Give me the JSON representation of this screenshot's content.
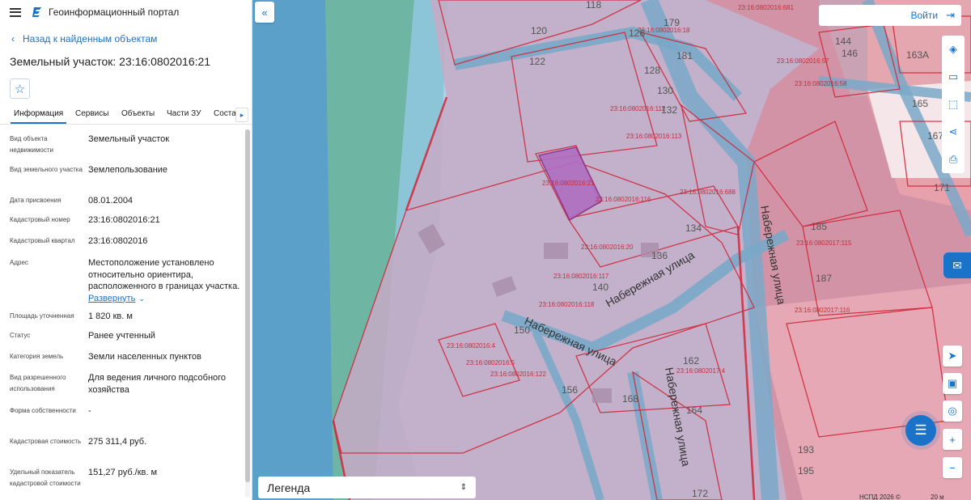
{
  "header": {
    "app_title": "Геоинформационный портал",
    "menu_icon": "menu-icon",
    "logo_icon": "portal-logo-icon"
  },
  "back_link": "Назад к найденным объектам",
  "object_title": "Земельный участок: 23:16:0802016:21",
  "favorite_icon": "star-icon",
  "tabs": [
    {
      "label": "Информация",
      "active": true
    },
    {
      "label": "Сервисы"
    },
    {
      "label": "Объекты"
    },
    {
      "label": "Части ЗУ"
    },
    {
      "label": "Соста"
    }
  ],
  "properties": [
    {
      "label": "Вид объекта недвижимости",
      "value": "Земельный участок"
    },
    {
      "label": "Вид земельного участка",
      "value": "Землепользование"
    },
    {
      "label": "Дата присвоения",
      "value": "08.01.2004"
    },
    {
      "label": "Кадастровый номер",
      "value": "23:16:0802016:21"
    },
    {
      "label": "Кадастровый квартал",
      "value": "23:16:0802016"
    },
    {
      "label": "Адрес",
      "value": "Местоположение установлено относительно ориентира, расположенного в границах участка.",
      "expand_label": "Развернуть"
    },
    {
      "label": "Площадь уточненная",
      "value": "1 820 кв. м"
    },
    {
      "label": "Статус",
      "value": "Ранее учтенный"
    },
    {
      "label": "Категория земель",
      "value": "Земли населенных пунктов"
    },
    {
      "label": "Вид разрешенного использования",
      "value": "Для ведения личного подсобного хозяйства"
    },
    {
      "label": "Форма собственности",
      "value": "-"
    },
    {
      "label": "Кадастровая стоимость",
      "value": "275 311,4 руб."
    },
    {
      "label": "Удельный показатель кадастровой стоимости",
      "value": "151,27 руб./кв. м"
    }
  ],
  "map": {
    "login_label": "Войти",
    "legend_label": "Легенда",
    "attribution": "НСПД 2026 ©",
    "scale_label": "20 м",
    "street_labels": [
      "Набережная улица",
      "Набережная улица",
      "Набережная улица",
      "Набережная улица"
    ],
    "parcel_labels": [
      "23:16:0802016:21",
      "23:16:0802016:116",
      "23:16:0802016:688",
      "23:16:0802016:113",
      "23:16:0802016:20",
      "23:16:0802016:117",
      "23:16:0802016:118",
      "23:16:0802016:4",
      "23:16:0802016:5",
      "23:16:0802016:122",
      "23:16:0802016:18",
      "23:16:0802016:57",
      "23:16:0802016:58",
      "23:16:0802017:4",
      "23:16:0802017:115",
      "23:16:0802017:116",
      "23:16:0802016:112",
      "23:16:0802016:681"
    ],
    "house_numbers": [
      "118",
      "120",
      "126",
      "179",
      "181",
      "122",
      "128",
      "130",
      "132",
      "134",
      "136",
      "140",
      "156",
      "150",
      "162",
      "164",
      "168",
      "185",
      "187",
      "193",
      "195",
      "144",
      "146",
      "163А",
      "165",
      "167",
      "171",
      "172"
    ],
    "colors": {
      "water": "#aed3e6",
      "river_dark": "#5aa0c8",
      "green": "#6fb5a3",
      "parcel_fill": "#c7a9c6",
      "parcel_red": "#e07b88",
      "border_red": "#d0283a",
      "street": "#7aa8c8",
      "selected": "#b06ec0",
      "accent": "#1a73c8"
    }
  }
}
